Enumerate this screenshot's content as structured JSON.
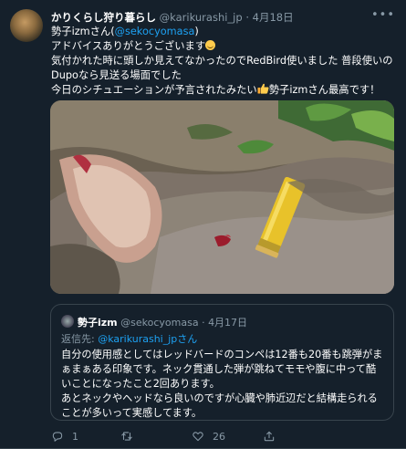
{
  "tweet": {
    "display_name": "かりくらし狩り暮らし",
    "handle": "@karikurashi_jp",
    "separator": "·",
    "date": "4月18日",
    "line1_prefix": "勢子izmさん(",
    "line1_mention": "@sekocyomasa",
    "line1_suffix": ")",
    "line2": "アドバイスありがとうございます",
    "line3": "気付かれた時に頭しか見えてなかったのでRedBird使いました 普段使いの",
    "line4": "Dupoなら見送る場面でした",
    "line5_a": "今日のシチュエーションが予言されたみたい",
    "line5_b": "勢子izmさん最高です！"
  },
  "quote": {
    "display_name": "勢子izm",
    "handle": "@sekocyomasa",
    "separator": "·",
    "date": "4月17日",
    "reply_label": "返信先:",
    "reply_to": "@karikurashi_jpさん",
    "lines": [
      "自分の使用感としてはレッドバードのコンペは12番も20番も跳弾がま",
      "ぁまぁある印象です。ネック貫通した弾が跳ねてモモや腹に中って酷",
      "いことになったこと2回あります。",
      "あとネックやヘッドなら良いのですが心臓や肺近辺だと結構走られる",
      "ことが多いって実感してます。"
    ]
  },
  "actions": {
    "reply_count": "1",
    "retweet_count": "",
    "like_count": "26",
    "share_count": ""
  },
  "colors": {
    "background": "#15202b",
    "text": "#ffffff",
    "secondary": "#8899a6",
    "link": "#1da1f2",
    "border": "#38444d"
  }
}
